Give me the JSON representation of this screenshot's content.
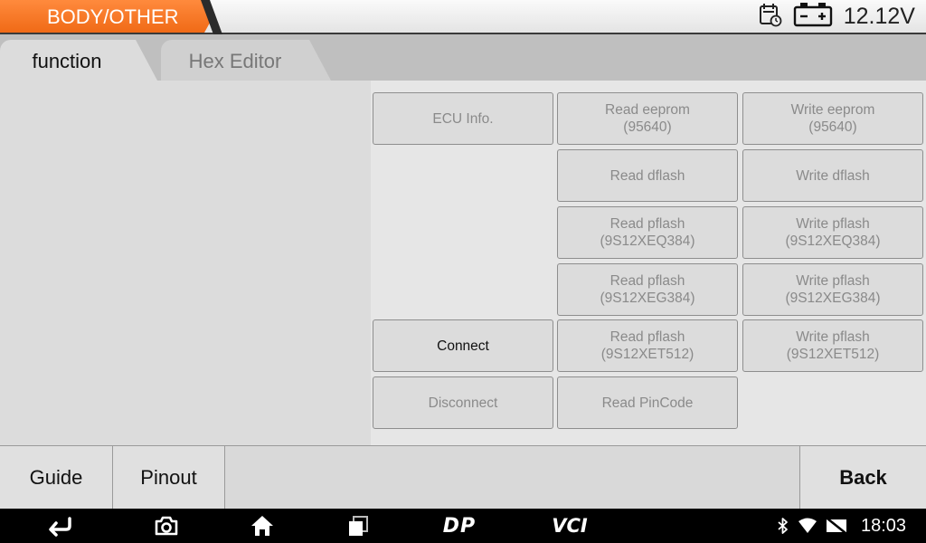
{
  "header": {
    "title": "BODY/OTHER",
    "voltage": "12.12V",
    "accent_color": "#f06a16"
  },
  "tabs": [
    {
      "label": "function",
      "active": true
    },
    {
      "label": "Hex Editor",
      "active": false
    }
  ],
  "functions": {
    "ecu_info": {
      "label": "ECU Info.",
      "enabled": false
    },
    "read_eeprom": {
      "line1": "Read eeprom",
      "line2": "(95640)",
      "enabled": false
    },
    "write_eeprom": {
      "line1": "Write eeprom",
      "line2": "(95640)",
      "enabled": false
    },
    "read_dflash": {
      "label": "Read dflash",
      "enabled": false
    },
    "write_dflash": {
      "label": "Write dflash",
      "enabled": false
    },
    "read_pflash_q384": {
      "line1": "Read pflash",
      "line2": "(9S12XEQ384)",
      "enabled": false
    },
    "write_pflash_q384": {
      "line1": "Write pflash",
      "line2": "(9S12XEQ384)",
      "enabled": false
    },
    "read_pflash_g384": {
      "line1": "Read pflash",
      "line2": "(9S12XEG384)",
      "enabled": false
    },
    "write_pflash_g384": {
      "line1": "Write pflash",
      "line2": "(9S12XEG384)",
      "enabled": false
    },
    "connect": {
      "label": "Connect",
      "enabled": true
    },
    "read_pflash_t512": {
      "line1": "Read pflash",
      "line2": "(9S12XET512)",
      "enabled": false
    },
    "write_pflash_t512": {
      "line1": "Write pflash",
      "line2": "(9S12XET512)",
      "enabled": false
    },
    "disconnect": {
      "label": "Disconnect",
      "enabled": false
    },
    "read_pincode": {
      "label": "Read PinCode",
      "enabled": false
    }
  },
  "toolbar": {
    "guide": "Guide",
    "pinout": "Pinout",
    "back": "Back"
  },
  "navbar": {
    "icons": [
      "back-arrow-icon",
      "camera-icon",
      "home-icon",
      "recent-apps-icon",
      "dp-logo-icon",
      "vci-logo-icon",
      "bluetooth-icon",
      "wifi-icon",
      "no-sim-icon"
    ],
    "dp_text": "DP",
    "vci_text": "VCI",
    "time": "18:03"
  }
}
